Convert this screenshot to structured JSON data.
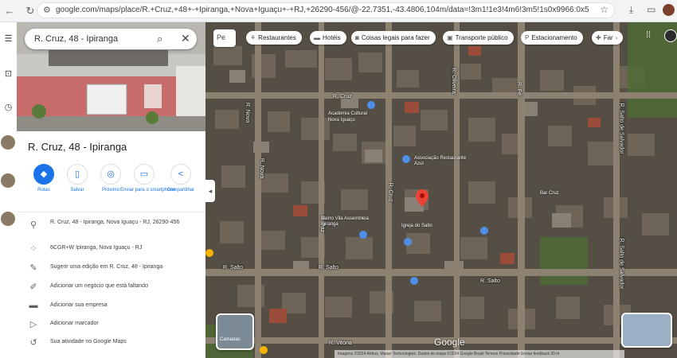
{
  "browser": {
    "url": "google.com/maps/place/R.+Cruz,+48+-+Ipiranga,+Nova+Iguaçu+-+RJ,+26290-456/@-22.7351,-43.4806,104m/data=!3m1!1e3!4m6!3m5!1s0x9966:0x59c4f!8m2!3d-22.73",
    "nav_icons": [
      "back-icon",
      "forward-icon",
      "reload-icon"
    ]
  },
  "place": {
    "search_value": "R. Cruz, 48 - Ipiranga",
    "title": "R. Cruz, 48 - Ipiranga",
    "actions": [
      {
        "label": "Rotas",
        "icon": "directions-icon"
      },
      {
        "label": "Salvar",
        "icon": "bookmark-icon"
      },
      {
        "label": "Próximo",
        "icon": "nearby-icon"
      },
      {
        "label": "Enviar para o smartphone",
        "icon": "send-to-phone-icon"
      },
      {
        "label": "Compartilhar",
        "icon": "share-icon"
      }
    ],
    "details": [
      {
        "icon": "pin-icon",
        "text": "R. Cruz, 48 - Ipiranga, Nova Iguaçu - RJ, 26290-456"
      },
      {
        "icon": "plus-code-icon",
        "text": "6CGR+W Ipiranga, Nova Iguaçu - RJ"
      },
      {
        "icon": "edit-icon",
        "text": "Sugerir uma edição em R. Cruz, 48 - Ipiranga"
      },
      {
        "icon": "pencil-icon",
        "text": "Adicionar um negócio que está faltando"
      },
      {
        "icon": "car-icon",
        "text": "Adicionar sua empresa"
      },
      {
        "icon": "label-icon",
        "text": "Adicionar marcador"
      },
      {
        "icon": "history-icon",
        "text": "Sua atividade no Google Maps"
      }
    ]
  },
  "map": {
    "layer_chip": "Pe",
    "chips": [
      {
        "label": "Restaurantes",
        "icon": "restaurant-icon"
      },
      {
        "label": "Hotéis",
        "icon": "hotel-icon"
      },
      {
        "label": "Coisas legais para fazer",
        "icon": "camera-icon"
      },
      {
        "label": "Transporte público",
        "icon": "transit-icon"
      },
      {
        "label": "Estacionamento",
        "icon": "parking-icon"
      },
      {
        "label": "Far",
        "icon": "pharmacy-icon"
      }
    ],
    "streets": [
      "R. Cruz",
      "R. Nova",
      "R. Nova",
      "R. Paz",
      "R. Cruz",
      "R. Oliveira",
      "R. Salto",
      "R. Salto",
      "R. Salto",
      "R. Fé",
      "R. Salto de Salvador",
      "R. Salto de Salvador",
      "R. Vitória"
    ],
    "pois": [
      "Academia Cultural",
      "Nova Iguaçu",
      "Associação Restaurante Azul",
      "Bairro Vila Assembleia Ipiranga",
      "Igreja do Salto",
      "Bar Cruz"
    ],
    "google_label": "Google",
    "layers_label": "Camadas",
    "attribution": "Imagens ©2024 Airbus, Maxar Technologies, Dados do mapa ©2024 Google  Brasil  Termos  Privacidade  Enviar feedback  20 m"
  },
  "colors": {
    "accent": "#1a73e8",
    "pin": "#ea4335"
  }
}
